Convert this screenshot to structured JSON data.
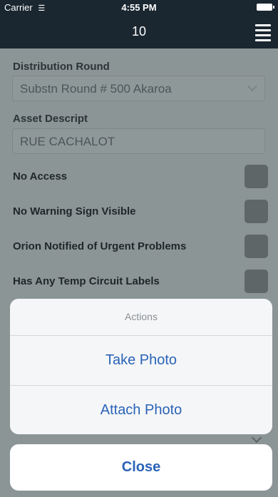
{
  "status_bar": {
    "carrier": "Carrier",
    "wifi_icon": "wifi-icon",
    "time": "4:55 PM",
    "battery_icon": "battery-icon"
  },
  "nav": {
    "title": "10",
    "menu_icon": "menu-icon"
  },
  "form": {
    "distribution_round": {
      "label": "Distribution Round",
      "value": "Substn Round #  500 Akaroa"
    },
    "asset_descript": {
      "label": "Asset Descript",
      "value": "RUE CACHALOT"
    },
    "checkboxes": [
      {
        "label": "No Access",
        "checked": false
      },
      {
        "label": "No Warning Sign Visible",
        "checked": false
      },
      {
        "label": "Orion Notified of Urgent Problems",
        "checked": false
      },
      {
        "label": "Has Any Temp Circuit Labels",
        "checked": false
      }
    ]
  },
  "action_sheet": {
    "title": "Actions",
    "buttons": [
      "Take Photo",
      "Attach Photo"
    ],
    "close": "Close"
  },
  "colors": {
    "nav_bg": "#1a2630",
    "overlay_bg": "#8c9596",
    "action_text": "#2a63b8",
    "sheet_bg": "#f5f6f7"
  }
}
